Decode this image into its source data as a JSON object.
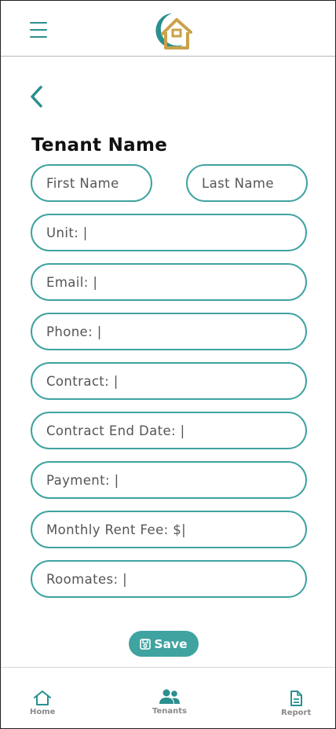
{
  "header": {
    "menu_icon": "hamburger-menu-icon",
    "logo_icon": "home-logo-icon"
  },
  "back_icon": "chevron-left-icon",
  "page_title": "Tenant Name",
  "form": {
    "first_name_placeholder": "First Name",
    "last_name_placeholder": "Last Name",
    "unit": "Unit: |",
    "email": "Email: |",
    "phone": "Phone: |",
    "contract": "Contract: |",
    "contract_end_date": "Contract End Date: |",
    "payment": "Payment: |",
    "monthly_rent_fee": "Monthly Rent Fee: $|",
    "roommates": "Roomates: |"
  },
  "save_label": "Save",
  "nav": {
    "home": "Home",
    "tenants": "Tenants",
    "report": "Report"
  },
  "colors": {
    "accent": "#3fa3a0",
    "logo_gold": "#c9a24a",
    "logo_teal": "#2b8f8f"
  }
}
